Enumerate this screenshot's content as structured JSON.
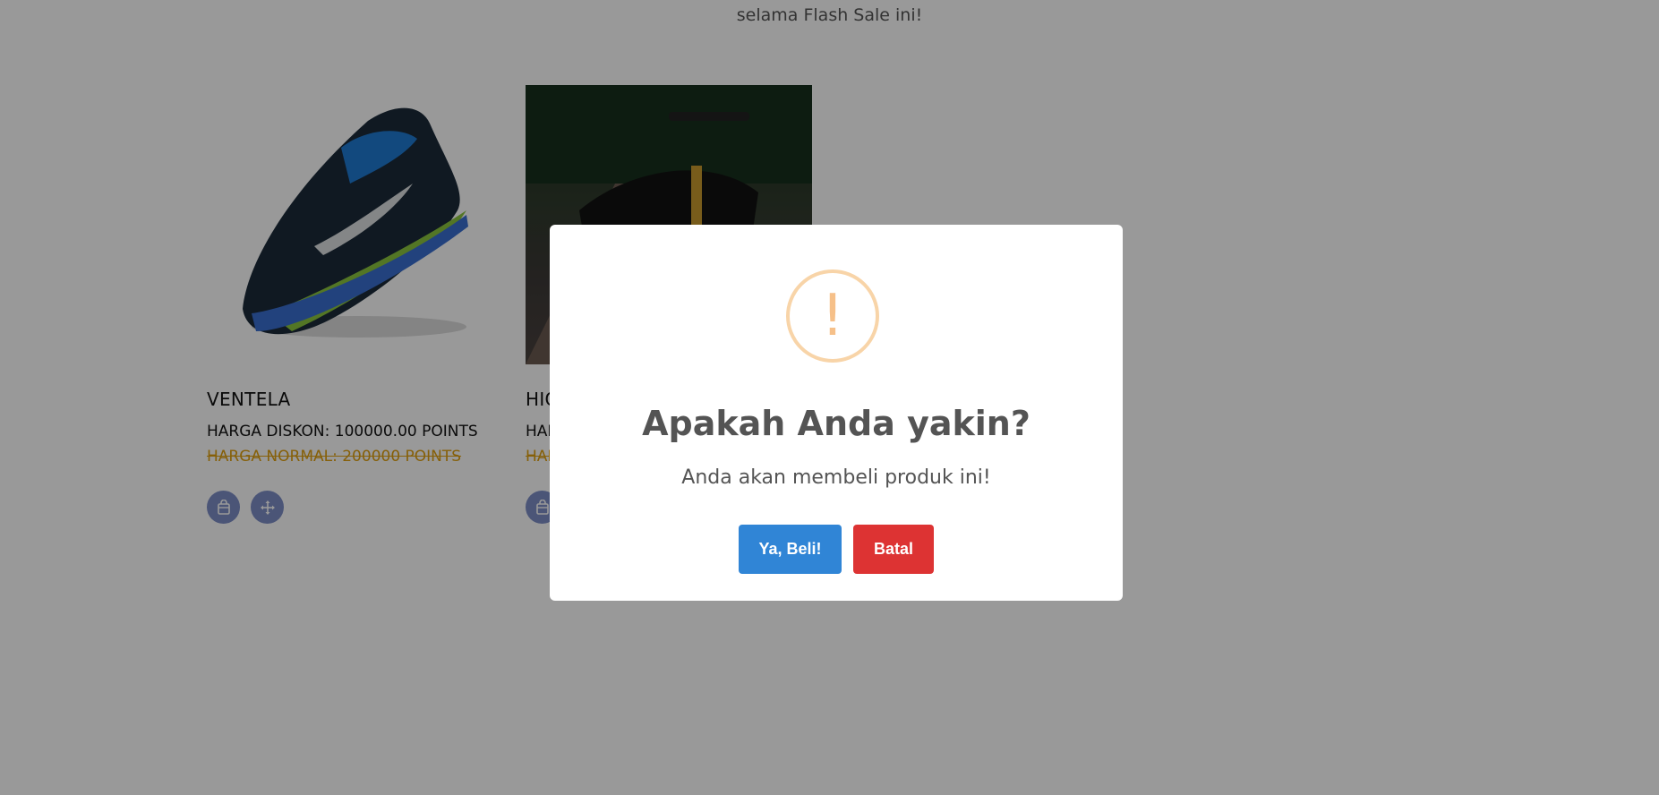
{
  "page": {
    "subtitle": "selama Flash Sale ini!"
  },
  "products": [
    {
      "name": "VENTELA",
      "discount_price": "HARGA DISKON: 100000.00 POINTS",
      "normal_price": "HARGA NORMAL: 200000 POINTS"
    },
    {
      "name": "HIG",
      "discount_price": "HAR",
      "normal_price": "HAR"
    }
  ],
  "icons": {
    "buy": "shopping-bag-icon",
    "move": "move-arrows-icon",
    "warning": "exclamation-icon"
  },
  "colors": {
    "overlay": "rgba(0,0,0,0.4)",
    "confirm": "#3085d6",
    "cancel": "#dd3333",
    "warning": "#f8bb86",
    "strike_price": "#e0a010",
    "icon_button": "#7d8ec7"
  },
  "dialog": {
    "icon_glyph": "!",
    "title": "Apakah Anda yakin?",
    "text": "Anda akan membeli produk ini!",
    "confirm_label": "Ya, Beli!",
    "cancel_label": "Batal"
  }
}
